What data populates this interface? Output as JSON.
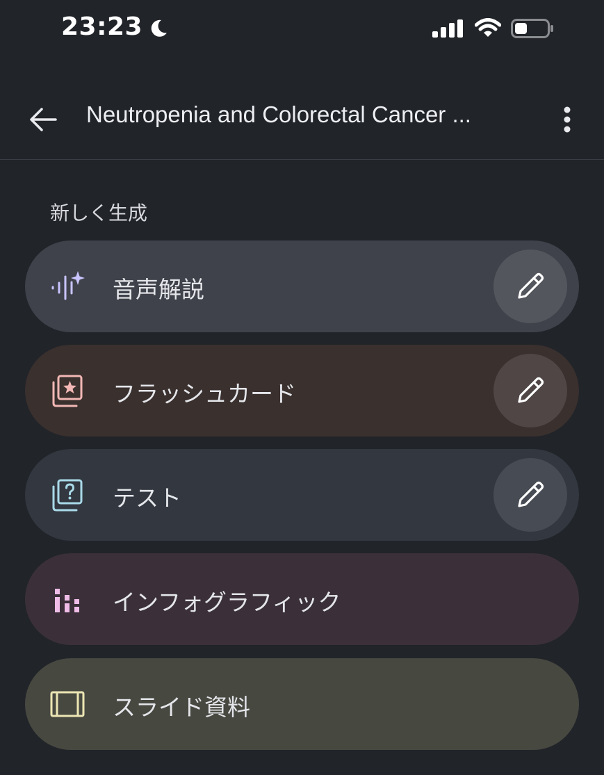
{
  "status_bar": {
    "time": "23:23",
    "icons": [
      "moon-icon",
      "signal-icon",
      "wifi-icon",
      "battery-icon"
    ]
  },
  "header": {
    "title": "Neutropenia and Colorectal Cancer ...",
    "back_icon": "arrow-left-icon",
    "more_icon": "more-vertical-icon"
  },
  "section": {
    "label": "新しく生成"
  },
  "actions": [
    {
      "label": "音声解説",
      "icon": "audio-sparkle-icon",
      "bg": "#3f424a",
      "edit_bg": "#54565d",
      "has_edit": true
    },
    {
      "label": "フラッシュカード",
      "icon": "flashcards-icon",
      "bg": "#3a302e",
      "edit_bg": "#4f4645",
      "has_edit": true
    },
    {
      "label": "テスト",
      "icon": "quiz-icon",
      "bg": "#323740",
      "edit_bg": "#474b53",
      "has_edit": true
    },
    {
      "label": "インフォグラフィック",
      "icon": "infographic-icon",
      "bg": "#3b3039",
      "has_edit": false
    },
    {
      "label": "スライド資料",
      "icon": "slides-icon",
      "bg": "#474840",
      "has_edit": false
    }
  ],
  "colors": {
    "background": "#212429",
    "audio_icon": "#c9c4ff",
    "flashcards_icon": "#f2b8b5",
    "quiz_icon": "#a9d9e8",
    "infographic_icon": "#f0bde8",
    "slides_icon": "#ece6b4"
  }
}
